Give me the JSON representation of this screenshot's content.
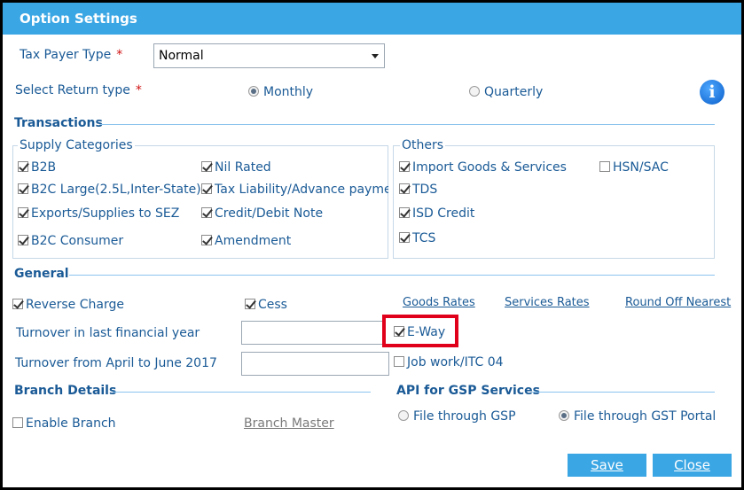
{
  "title": "Option Settings",
  "taxpayer": {
    "label": "Tax Payer Type",
    "required_mark": "*",
    "value": "Normal"
  },
  "return_type": {
    "label": "Select Return type",
    "required_mark": "*",
    "options": [
      {
        "label": "Monthly",
        "selected": true
      },
      {
        "label": "Quarterly",
        "selected": false
      }
    ]
  },
  "info_icon": "i",
  "transactions": {
    "title": "Transactions",
    "supply": {
      "legend": "Supply Categories",
      "items": [
        {
          "label": "B2B",
          "checked": true
        },
        {
          "label": "Nil Rated",
          "checked": true
        },
        {
          "label": "B2C Large(2.5L,Inter-State)",
          "checked": true
        },
        {
          "label": "Tax Liability/Advance payme",
          "checked": true
        },
        {
          "label": "Exports/Supplies to SEZ",
          "checked": true
        },
        {
          "label": "Credit/Debit Note",
          "checked": true
        },
        {
          "label": "B2C Consumer",
          "checked": true
        },
        {
          "label": "Amendment",
          "checked": true
        }
      ]
    },
    "others": {
      "legend": "Others",
      "items": [
        {
          "label": "Import Goods & Services",
          "checked": true
        },
        {
          "label": "HSN/SAC",
          "checked": false
        },
        {
          "label": "TDS",
          "checked": true
        },
        {
          "label": "ISD Credit",
          "checked": true
        },
        {
          "label": "TCS",
          "checked": true
        }
      ]
    }
  },
  "general": {
    "title": "General",
    "reverse_charge": "Reverse Charge",
    "cess": "Cess",
    "goods_rates": "Goods Rates",
    "services_rates": "Services Rates",
    "round_off": "Round Off Nearest",
    "turnover_last_year": "Turnover in last financial year",
    "turnover_april_june": "Turnover from April to June 2017",
    "eway": "E-Way",
    "job_work": "Job work/ITC 04"
  },
  "branch": {
    "title": "Branch Details",
    "enable": "Enable Branch",
    "master": "Branch Master"
  },
  "api": {
    "title": "API for GSP Services",
    "via_gsp": "File through GSP",
    "via_portal": "File through GST Portal"
  },
  "buttons": {
    "save": "Save",
    "close": "Close"
  },
  "colors": {
    "accent": "#3ba6e4",
    "label": "#1a5a96",
    "highlight": "#e0001a"
  }
}
